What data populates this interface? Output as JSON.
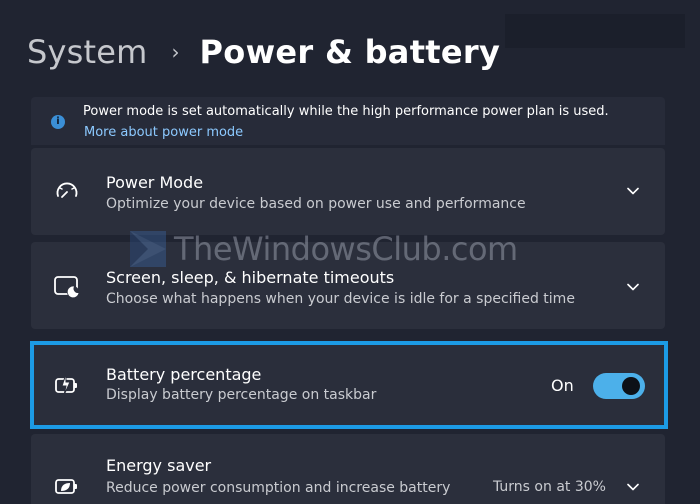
{
  "breadcrumb": {
    "parent": "System",
    "separator": "›",
    "current": "Power & battery"
  },
  "info_banner": {
    "icon": "info-icon",
    "text": "Power mode is set automatically while the high performance power plan is used.",
    "link": "More about power mode"
  },
  "cards": {
    "power_mode": {
      "icon": "gauge-icon",
      "title": "Power Mode",
      "description": "Optimize your device based on power use and performance"
    },
    "screen_sleep": {
      "icon": "screen-moon-icon",
      "title": "Screen, sleep, & hibernate timeouts",
      "description": "Choose what happens when your device is idle for a specified time"
    },
    "battery_percentage": {
      "icon": "battery-charging-icon",
      "title": "Battery percentage",
      "description": "Display battery percentage on taskbar",
      "toggle_state": "On",
      "toggle_on": true
    },
    "energy_saver": {
      "icon": "energy-saver-icon",
      "title": "Energy saver",
      "description": "Reduce power consumption and increase battery",
      "status": "Turns on at 30%"
    }
  },
  "watermark": {
    "text": "TheWindowsClub.com"
  },
  "colors": {
    "background": "#202431",
    "card": "#2b2f3c",
    "accent": "#4cb0ea",
    "highlight_border": "#1c9be5",
    "link": "#8cc9ff"
  }
}
